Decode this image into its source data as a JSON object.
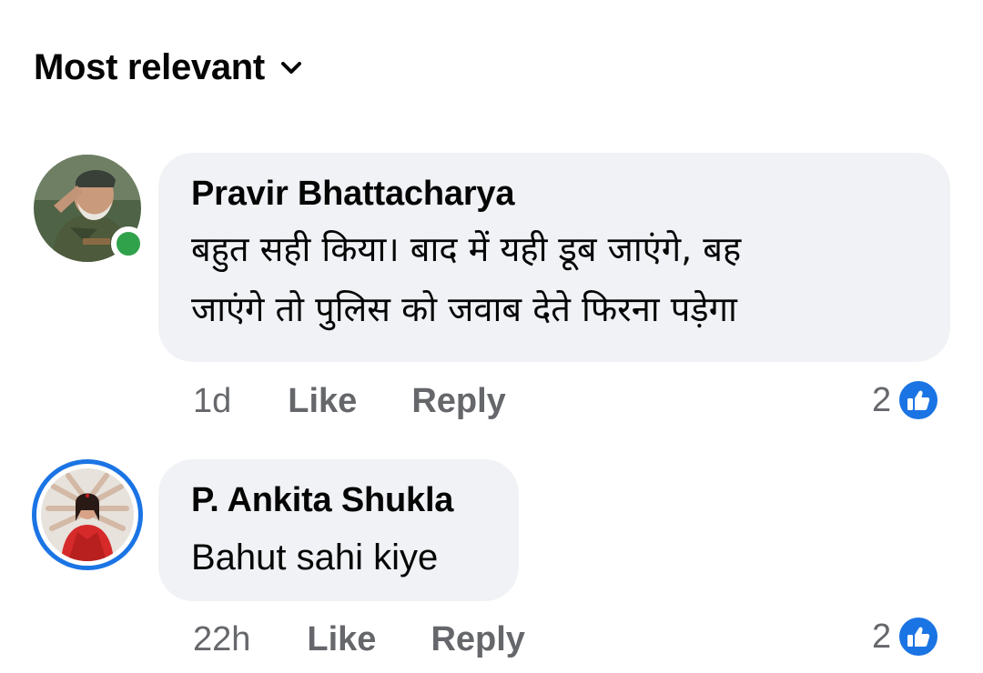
{
  "sort": {
    "label": "Most relevant",
    "icon": "chevron-down-icon"
  },
  "comments": [
    {
      "author": "Pravir Bhattacharya",
      "text_line1": "बहुत सही किया। बाद में यही डूब जाएंगे, बह",
      "text_line2": "जाएंगे तो पुलिस को जवाब देते फिरना पड़ेगा",
      "time": "1d",
      "like_label": "Like",
      "reply_label": "Reply",
      "reaction_count": "2",
      "online": true
    },
    {
      "author": "P. Ankita Shukla",
      "text_line1": "Bahut sahi kiye",
      "time": "22h",
      "like_label": "Like",
      "reply_label": "Reply",
      "reaction_count": "2",
      "story_ring": true
    }
  ],
  "colors": {
    "accent": "#1b74e4",
    "online": "#31a24c",
    "bubble": "#f0f2f5",
    "muted": "#65676b"
  }
}
